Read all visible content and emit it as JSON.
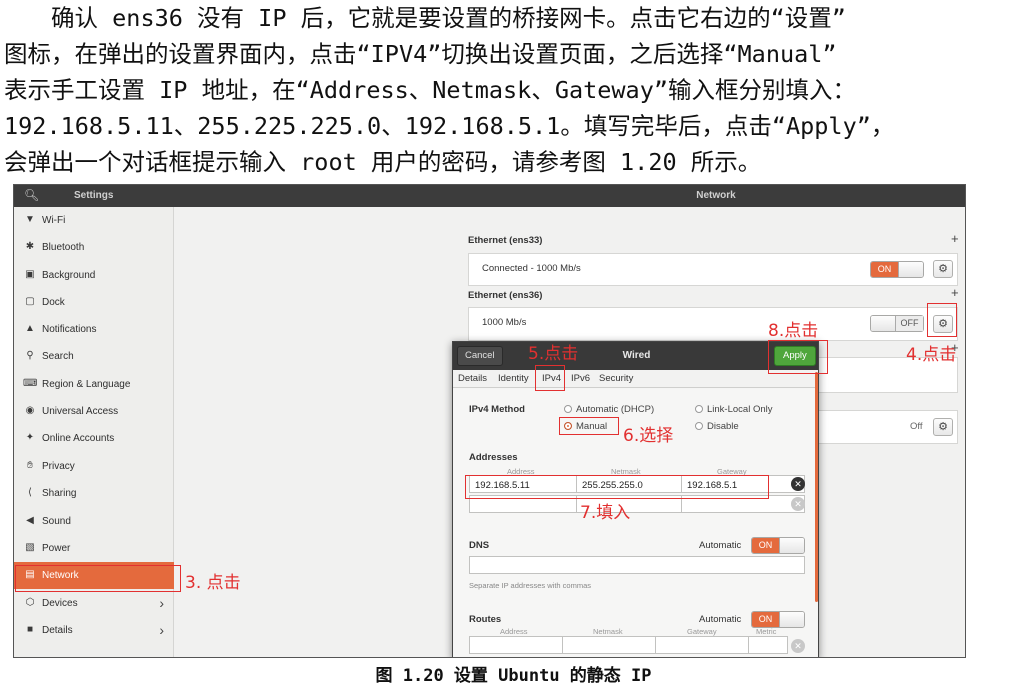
{
  "doc": {
    "lines": [
      "确认 ens36 没有 IP 后，它就是要设置的桥接网卡。点击它右边的“设置”",
      "图标，在弹出的设置界面内，点击“IPV4”切换出设置页面，之后选择“Manual”",
      "表示手工设置 IP 地址，在“Address、Netmask、Gateway”输入框分别填入：",
      "192.168.5.11、255.225.225.0、192.168.5.1。填写完毕后，点击“Apply”，",
      "会弹出一个对话框提示输入 root 用户的密码，请参考图 1.20 所示。"
    ],
    "caption": "图 1.20 设置 Ubuntu 的静态 IP"
  },
  "topbar": {
    "settings_title": "Settings",
    "network_title": "Network",
    "search_icon": "search-icon"
  },
  "sidebar": {
    "items": [
      {
        "label": "Wi-Fi",
        "icon": "wifi-icon"
      },
      {
        "label": "Bluetooth",
        "icon": "bluetooth-icon"
      },
      {
        "label": "Background",
        "icon": "background-icon"
      },
      {
        "label": "Dock",
        "icon": "dock-icon"
      },
      {
        "label": "Notifications",
        "icon": "bell-icon"
      },
      {
        "label": "Search",
        "icon": "search-icon"
      },
      {
        "label": "Region & Language",
        "icon": "keyboard-icon"
      },
      {
        "label": "Universal Access",
        "icon": "accessibility-icon"
      },
      {
        "label": "Online Accounts",
        "icon": "accounts-icon"
      },
      {
        "label": "Privacy",
        "icon": "hand-icon"
      },
      {
        "label": "Sharing",
        "icon": "share-icon"
      },
      {
        "label": "Sound",
        "icon": "speaker-icon"
      },
      {
        "label": "Power",
        "icon": "battery-icon"
      },
      {
        "label": "Network",
        "icon": "network-icon",
        "active": true
      },
      {
        "label": "Devices",
        "icon": "devices-icon",
        "has_arrow": true
      },
      {
        "label": "Details",
        "icon": "info-icon",
        "has_arrow": true
      }
    ]
  },
  "network": {
    "ens33": {
      "title": "Ethernet (ens33)",
      "status": "Connected - 1000 Mb/s",
      "toggle": "ON"
    },
    "ens36": {
      "title": "Ethernet (ens36)",
      "status": "1000 Mb/s",
      "toggle": "OFF"
    },
    "other_off": "Off",
    "plus": "+"
  },
  "dialog": {
    "title": "Wired",
    "cancel": "Cancel",
    "apply": "Apply",
    "tabs": [
      "Details",
      "Identity",
      "IPv4",
      "IPv6",
      "Security"
    ],
    "ipv4_method_label": "IPv4 Method",
    "methods": [
      "Automatic (DHCP)",
      "Link-Local Only",
      "Manual",
      "Disable"
    ],
    "addresses_label": "Addresses",
    "col_address": "Address",
    "col_netmask": "Netmask",
    "col_gateway": "Gateway",
    "address": "192.168.5.11",
    "netmask": "255.255.255.0",
    "gateway": "192.168.5.1",
    "dns_label": "DNS",
    "automatic": "Automatic",
    "on": "ON",
    "dns_hint": "Separate IP addresses with commas",
    "routes_label": "Routes",
    "col_metric": "Metric"
  },
  "annotations": {
    "step3": "3. 点击",
    "step4": "4.点击",
    "step5": "5.点击",
    "step6": "6.选择",
    "step7": "7.填入",
    "step8": "8.点击"
  },
  "colors": {
    "accent": "#e46a3d",
    "apply": "#4fa63c",
    "annotation": "#e23030"
  }
}
